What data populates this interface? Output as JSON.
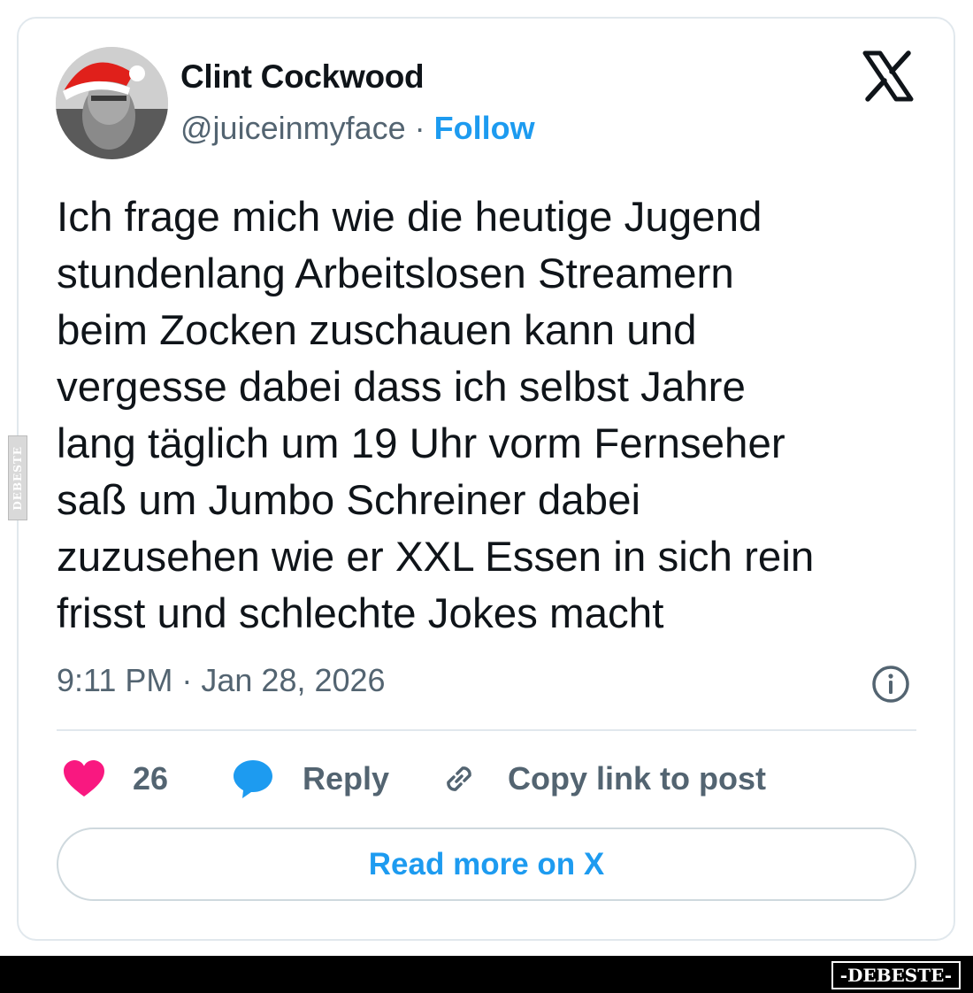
{
  "author": {
    "name": "Clint Cockwood",
    "handle": "@juiceinmyface",
    "separator": " · ",
    "follow_label": "Follow"
  },
  "tweet": {
    "text": "Ich frage mich wie die heutige Jugend\nstundenlang Arbeitslosen Streamern\nbeim Zocken zuschauen kann und\nvergesse dabei dass ich selbst Jahre\nlang täglich um 19 Uhr vorm Fernseher\nsaß um Jumbo Schreiner dabei\nzuzusehen wie er XXL Essen in sich rein\nfrisst und schlechte Jokes macht",
    "timestamp": "9:11 PM · Jan 28, 2026"
  },
  "actions": {
    "like_count": "26",
    "reply_label": "Reply",
    "copy_label": "Copy link to post"
  },
  "read_more_label": "Read more on X",
  "watermark": {
    "footer": "-DEBESTE-",
    "side": "DEBESTE"
  },
  "icons": {
    "brand": "x-logo-icon",
    "info": "info-icon",
    "like": "heart-icon",
    "reply": "speech-bubble-icon",
    "copy": "link-icon"
  },
  "colors": {
    "accent": "#1d9bf0",
    "like": "#f91880",
    "muted_text": "#536471",
    "border": "#e1e8ed"
  }
}
